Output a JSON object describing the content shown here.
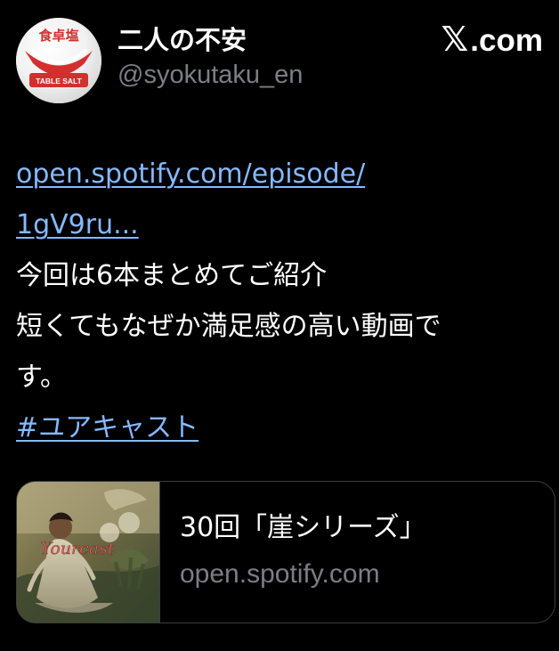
{
  "header": {
    "author_name": "二人の不安",
    "author_handle": "@syokutaku_en",
    "site_label": ".com",
    "site_icon": "x-logo-icon",
    "avatar_text_top": "食卓塩",
    "avatar_text_bottom": "TABLE SALT"
  },
  "tweet": {
    "link_line_1": "open.spotify.com/episode/",
    "link_line_2": "1gV9ru...",
    "line_1": "今回は6本まとめてご紹介",
    "line_2": "短くてもなぜか満足感の高い動画で",
    "line_3": "す。",
    "hashtag": "#ユアキャスト"
  },
  "card": {
    "title": "30回「崖シリーズ」",
    "domain": "open.spotify.com",
    "thumbnail_text": "Yourcast"
  },
  "colors": {
    "background": "#000000",
    "primary_text": "#ffffff",
    "secondary_text": "#7a7f85",
    "link": "#86b9ff",
    "card_border": "#3b3d41",
    "salt_red": "#d32f2f"
  }
}
